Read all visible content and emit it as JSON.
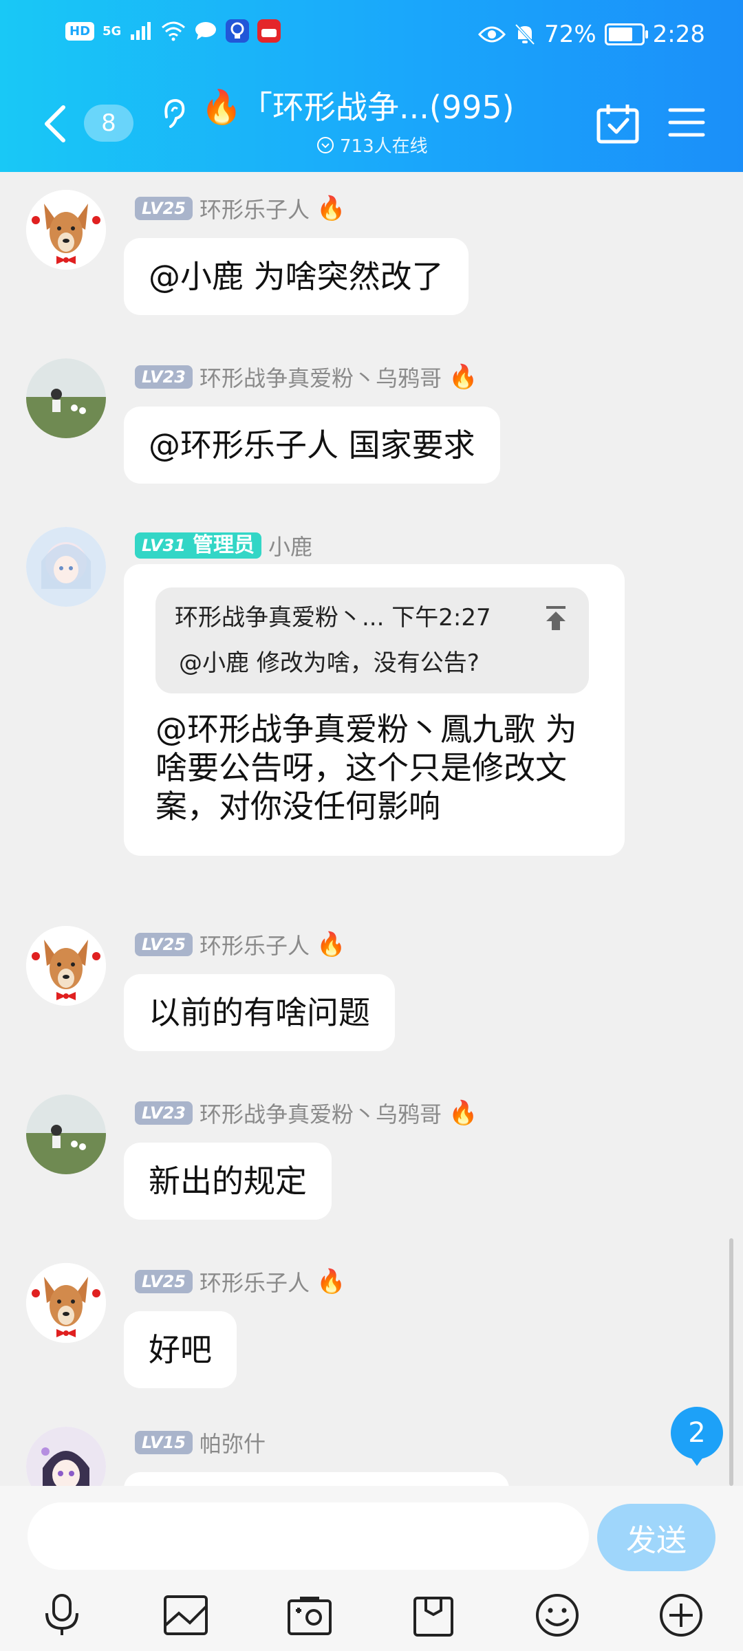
{
  "status_bar": {
    "hd": "HD",
    "signal": "5G",
    "battery": "72%",
    "time": "2:28"
  },
  "header": {
    "unread_count": "8",
    "title": "「环形战争...(995)",
    "online": "713人在线"
  },
  "messages": [
    {
      "level": "LV25",
      "name": "环形乐子人",
      "text": "@小鹿 为啥突然改了"
    },
    {
      "level": "LV23",
      "name": "环形战争真爱粉丶乌鸦哥",
      "text": "@环形乐子人 国家要求"
    },
    {
      "level": "LV31",
      "badge": "管理员",
      "name": "小鹿",
      "quote_header": "环形战争真爱粉丶... 下午2:27",
      "quote_text": "@小鹿 修改为啥，没有公告?",
      "text": "@环形战争真爱粉丶鳳九歌 为啥要公告呀，这个只是修改文案，对你没任何影响"
    },
    {
      "level": "LV25",
      "name": "环形乐子人",
      "text": "以前的有啥问题"
    },
    {
      "level": "LV23",
      "name": "环形战争真爱粉丶乌鸦哥",
      "text": "新出的规定"
    },
    {
      "level": "LV25",
      "name": "环形乐子人",
      "text": "好吧"
    },
    {
      "level": "LV15",
      "name": "帕弥什",
      "text": ""
    }
  ],
  "new_message_count": "2",
  "input": {
    "placeholder": "",
    "send_label": "发送"
  },
  "toolbar": {
    "icons": [
      "microphone-icon",
      "image-icon",
      "camera-icon",
      "gift-box-icon",
      "emoji-icon",
      "plus-icon"
    ]
  },
  "colors": {
    "header_start": "#19c8f6",
    "header_end": "#1b8ff9",
    "admin_badge": "#33d6c6",
    "level_badge": "#a9b4cb",
    "send_button": "#9fd6fb"
  }
}
